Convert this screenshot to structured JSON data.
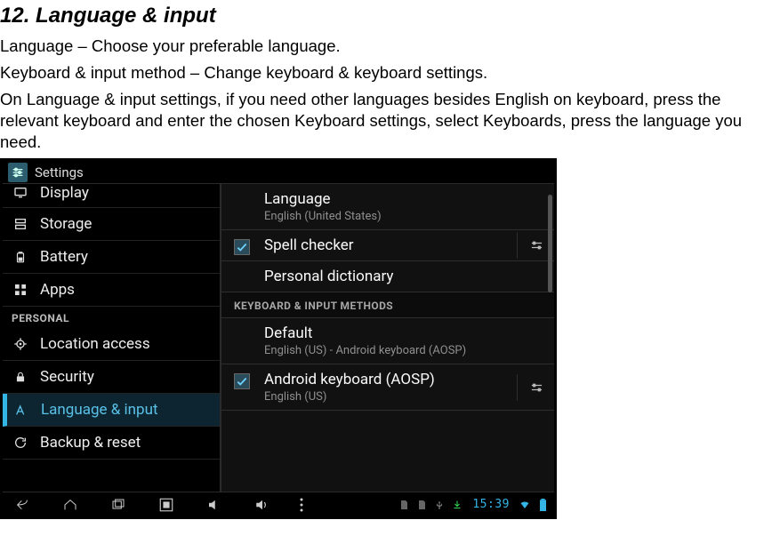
{
  "doc": {
    "heading": "12. Language & input",
    "line1": "Language – Choose your preferable language.",
    "line2": "Keyboard & input method – Change keyboard & keyboard settings.",
    "line3": "On Language & input settings, if you need other languages besides English on keyboard, press the relevant keyboard and enter the chosen Keyboard settings, select Keyboards, press the language you need."
  },
  "header": {
    "title": "Settings"
  },
  "sidebar": {
    "items": [
      {
        "label": "Display"
      },
      {
        "label": "Storage"
      },
      {
        "label": "Battery"
      },
      {
        "label": "Apps"
      }
    ],
    "section_header": "PERSONAL",
    "personal_items": [
      {
        "label": "Location access"
      },
      {
        "label": "Security"
      },
      {
        "label": "Language & input"
      },
      {
        "label": "Backup & reset"
      }
    ]
  },
  "pane": {
    "language": {
      "title": "Language",
      "sub": "English (United States)"
    },
    "spell": {
      "title": "Spell checker"
    },
    "personal_dict": {
      "title": "Personal dictionary"
    },
    "section_header": "KEYBOARD & INPUT METHODS",
    "default": {
      "title": "Default",
      "sub": "English (US) - Android keyboard (AOSP)"
    },
    "kb": {
      "title": "Android keyboard (AOSP)",
      "sub": "English (US)"
    },
    "cutoff": ""
  },
  "navbar": {
    "clock": "15:39"
  },
  "colors": {
    "accent": "#33b5e5"
  }
}
